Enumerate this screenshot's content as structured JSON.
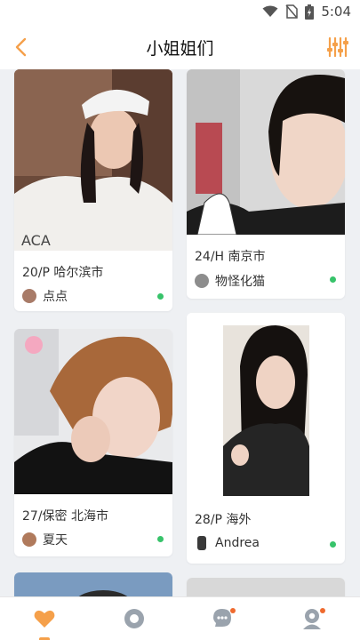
{
  "status_bar": {
    "time": "5:04"
  },
  "header": {
    "title": "小姐姐们"
  },
  "cards": [
    {
      "meta": "20/P    哈尔滨市",
      "user": "点点",
      "online": true
    },
    {
      "meta": "24/H    南京市",
      "user": "物怪化猫",
      "online": true
    },
    {
      "meta": "27/保密    北海市",
      "user": "夏天",
      "online": true
    },
    {
      "meta": "28/P    海外",
      "user": "Andrea",
      "online": true
    }
  ],
  "colors": {
    "accent": "#f5a04a",
    "online": "#37c36a",
    "badge": "#ef6a2e",
    "tab_inactive": "#9aa3ad"
  },
  "tabs": [
    {
      "icon": "heart-icon",
      "active": true
    },
    {
      "icon": "circle-icon",
      "active": false
    },
    {
      "icon": "chat-icon",
      "badge": true
    },
    {
      "icon": "profile-icon",
      "badge": true
    }
  ]
}
